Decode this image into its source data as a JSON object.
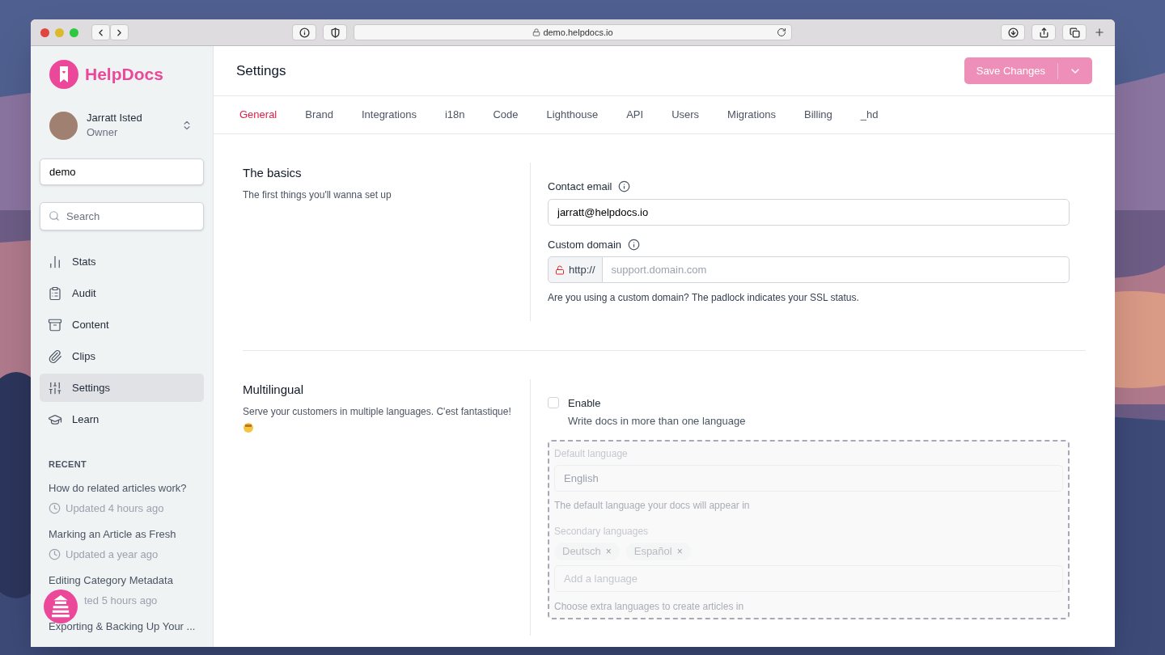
{
  "browser": {
    "url": "demo.helpdocs.io"
  },
  "sidebar": {
    "logo": "HelpDocs",
    "user": {
      "name": "Jarratt Isted",
      "role": "Owner"
    },
    "workspace": {
      "value": "demo"
    },
    "search": {
      "placeholder": "Search"
    },
    "nav": [
      {
        "label": "Stats",
        "selected": false
      },
      {
        "label": "Audit",
        "selected": false
      },
      {
        "label": "Content",
        "selected": false
      },
      {
        "label": "Clips",
        "selected": false
      },
      {
        "label": "Settings",
        "selected": true
      },
      {
        "label": "Learn",
        "selected": false
      }
    ],
    "recent_title": "RECENT",
    "recent": [
      {
        "title": "How do related articles work?",
        "updated": "Updated 4 hours ago",
        "covered": false
      },
      {
        "title": "Marking an Article as Fresh",
        "updated": "Updated a year ago",
        "covered": false
      },
      {
        "title": "Editing Category Metadata",
        "updated": "ted 5 hours ago",
        "covered": true
      },
      {
        "title": "Exporting & Backing Up Your ..."
      }
    ]
  },
  "header": {
    "title": "Settings",
    "save_button": {
      "label": "Save Changes",
      "disabled": true
    }
  },
  "tabs": [
    {
      "label": "General",
      "selected": true
    },
    {
      "label": "Brand",
      "selected": false
    },
    {
      "label": "Integrations",
      "selected": false
    },
    {
      "label": "i18n",
      "selected": false
    },
    {
      "label": "Code",
      "selected": false
    },
    {
      "label": "Lighthouse",
      "selected": false
    },
    {
      "label": "API",
      "selected": false
    },
    {
      "label": "Users",
      "selected": false
    },
    {
      "label": "Migrations",
      "selected": false
    },
    {
      "label": "Billing",
      "selected": false
    },
    {
      "label": "_hd",
      "selected": false
    }
  ],
  "basics": {
    "title": "The basics",
    "description": "The first things you'll wanna set up",
    "contact_email": {
      "label": "Contact email",
      "value": "jarratt@helpdocs.io"
    },
    "custom_domain": {
      "label": "Custom domain",
      "prefix": "http://",
      "placeholder": "support.domain.com",
      "help": "Are you using a custom domain? The padlock indicates your SSL status."
    }
  },
  "multilingual": {
    "title": "Multilingual",
    "description": "Serve your customers in multiple languages. C'est fantastique!",
    "enable": {
      "label": "Enable",
      "description": "Write docs in more than one language",
      "checked": false
    },
    "default_language": {
      "label": "Default language",
      "value": "English",
      "help": "The default language your docs will appear in"
    },
    "secondary_languages": {
      "label": "Secondary languages",
      "chips": [
        {
          "label": "Deutsch",
          "remove": "×"
        },
        {
          "label": "Español",
          "remove": "×"
        }
      ],
      "placeholder": "Add a language",
      "help": "Choose extra languages to create articles in"
    }
  }
}
